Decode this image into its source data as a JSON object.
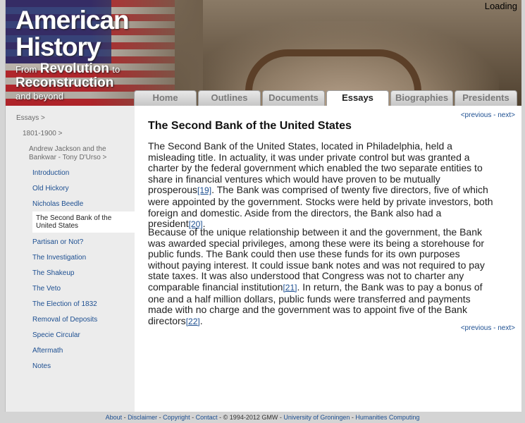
{
  "status": "Loading",
  "brand": {
    "line1": "American",
    "line2": "History",
    "sub_from": "From",
    "sub_revolution": "Revolution",
    "sub_to": "to",
    "sub_reconstruction": "Reconstruction",
    "sub_beyond": "and beyond"
  },
  "tabs": [
    "Home",
    "Outlines",
    "Documents",
    "Essays",
    "Biographies",
    "Presidents"
  ],
  "sidebar": {
    "crumbs": [
      "Essays >",
      "1801-1900 >",
      "Andrew Jackson and the Bankwar - Tony D'Urso >"
    ],
    "items": [
      "Introduction",
      "Old Hickory",
      "Nicholas Beedle",
      "The Second Bank of the United States",
      "Partisan or Not?",
      "The Investigation",
      "The Shakeup",
      "The Veto",
      "The Election of 1832",
      "Removal of Deposits",
      "Specie Circular",
      "Aftermath",
      "Notes"
    ]
  },
  "pager": {
    "previous": "<previous",
    "sep": " - ",
    "next": "next>"
  },
  "article": {
    "title": "The Second Bank of the United States",
    "p1_a": "The Second Bank of the United States, located in Philadelphia, held a misleading title. In actuality, it was under private control but was granted a charter by the federal government which enabled the two separate entities to share in financial ventures which would have proven to be mutually prosperous",
    "p1_ref1": "[19]",
    "p1_b": ". The Bank was comprised of twenty five directors, five of which were appointed by the government. Stocks were held by private investors, both foreign and domestic. Aside from the directors, the Bank also had a president",
    "p1_ref2": "[20]",
    "p1_c": ".",
    "p2_a": "Because of the unique relationship between it and the government, the Bank was awarded special privileges, among these were its being a storehouse for public funds. The Bank could then use these funds for its own purposes without paying interest. It could issue bank notes and was not required to pay state taxes. It was also understood that Congress was not to charter any comparable financial institution",
    "p2_ref1": "[21]",
    "p2_b": ". In return, the Bank was to pay a bonus of one and a half million dollars, public funds were transferred and payments made with no charge and the government was to appoint five of the Bank directors",
    "p2_ref2": "[22]",
    "p2_c": "."
  },
  "footer": {
    "about": "About",
    "disclaimer": "Disclaimer",
    "copyright": "Copyright",
    "contact": "Contact",
    "copy_text": "© 1994-2012 GMW",
    "university": "University of Groningen",
    "humanities": "Humanities Computing",
    "sep": " - "
  }
}
